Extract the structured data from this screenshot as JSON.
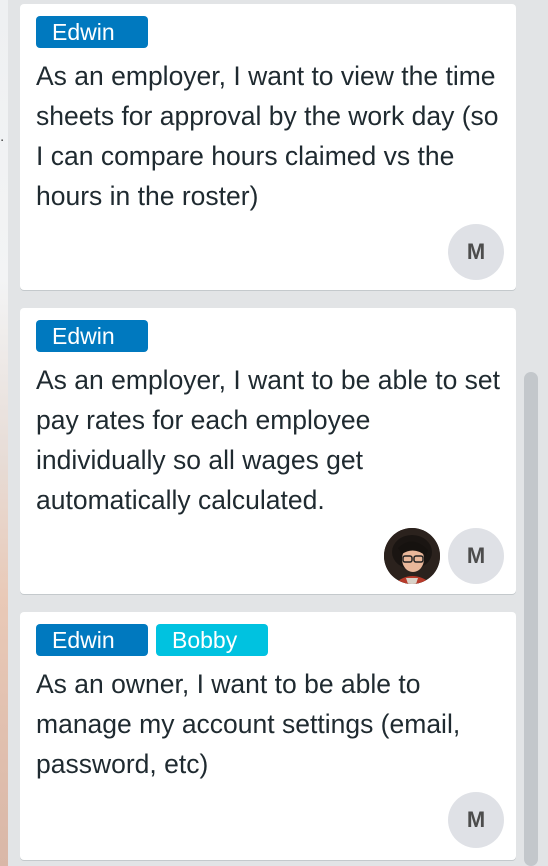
{
  "cards": [
    {
      "labels": [
        "Edwin"
      ],
      "title": "As an employer, I want to view the time sheets for approval by the work day (so I can compare hours claimed vs the hours in the roster)",
      "members": [
        {
          "initial": "M"
        }
      ]
    },
    {
      "labels": [
        "Edwin"
      ],
      "title": "As an employer, I want to be able to set pay rates for each employee individually so all wages get automatically calculated.",
      "members": [
        {
          "photo": "member-photo"
        },
        {
          "initial": "M"
        }
      ]
    },
    {
      "labels": [
        "Edwin",
        "Bobby"
      ],
      "title": "As an owner, I want to be able to manage my account settings (email, password, etc)",
      "members": [
        {
          "initial": "M"
        }
      ]
    }
  ],
  "colors": {
    "label_edwin": "#0079bf",
    "label_bobby": "#00c2e0",
    "board_background": "#e2e4e6"
  }
}
